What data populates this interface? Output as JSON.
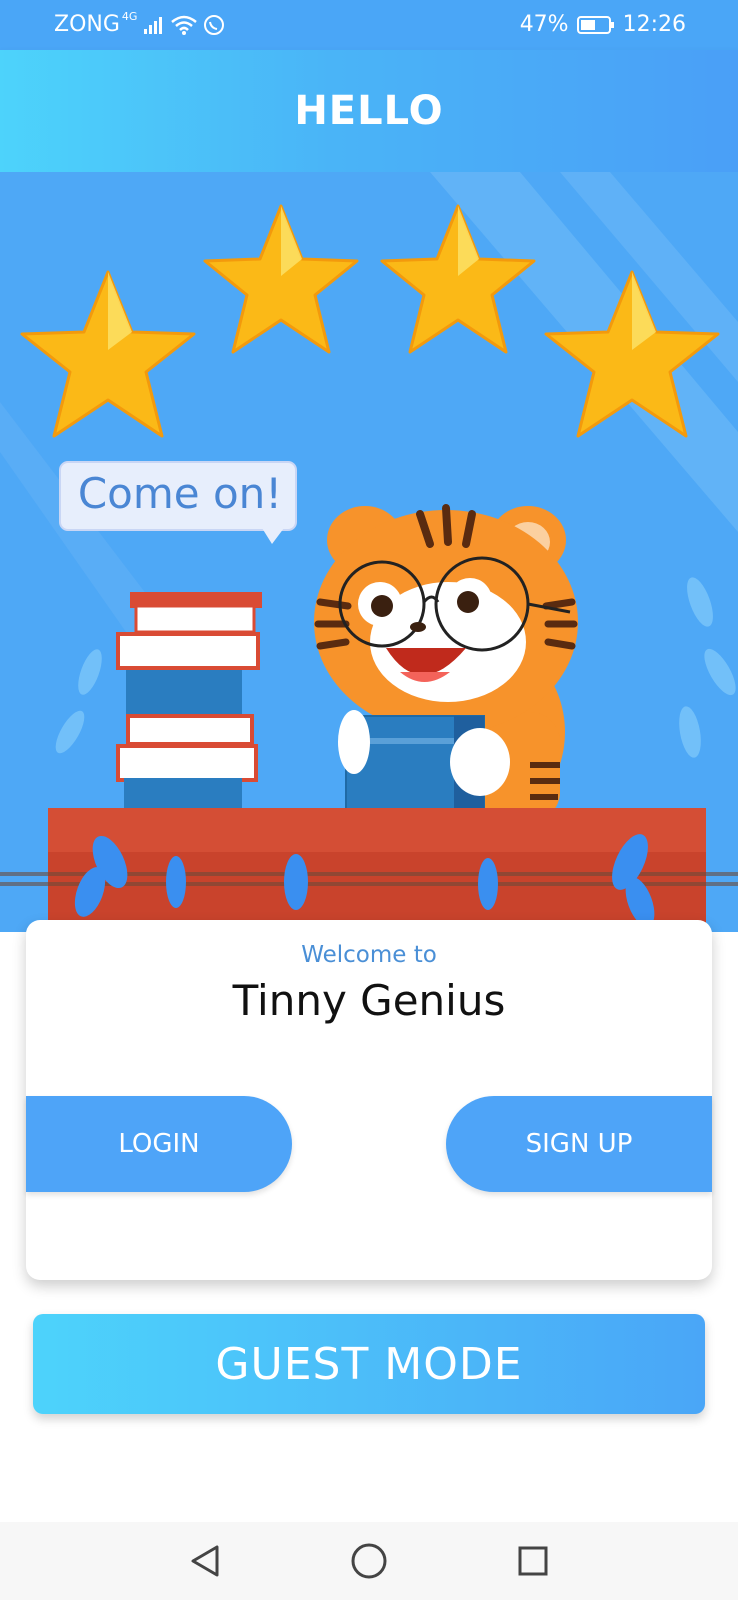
{
  "status_bar": {
    "carrier": "ZONG",
    "network": "4G",
    "battery": "47%",
    "time": "12:26"
  },
  "header": {
    "title": "HELLO"
  },
  "hero": {
    "speech_bubble": "Come on!",
    "star_count": 4
  },
  "card": {
    "welcome": "Welcome to",
    "app_name": "Tinny Genius",
    "login_label": "LOGIN",
    "signup_label": "SIGN UP"
  },
  "guest_mode": {
    "label": "GUEST MODE"
  },
  "navbar": {
    "back_icon": "back-triangle-icon",
    "home_icon": "home-circle-icon",
    "recents_icon": "recents-square-icon"
  },
  "colors": {
    "accent": "#4ea4f8",
    "gradient_start": "#4dd3fb",
    "tiger": "#f7932b"
  }
}
